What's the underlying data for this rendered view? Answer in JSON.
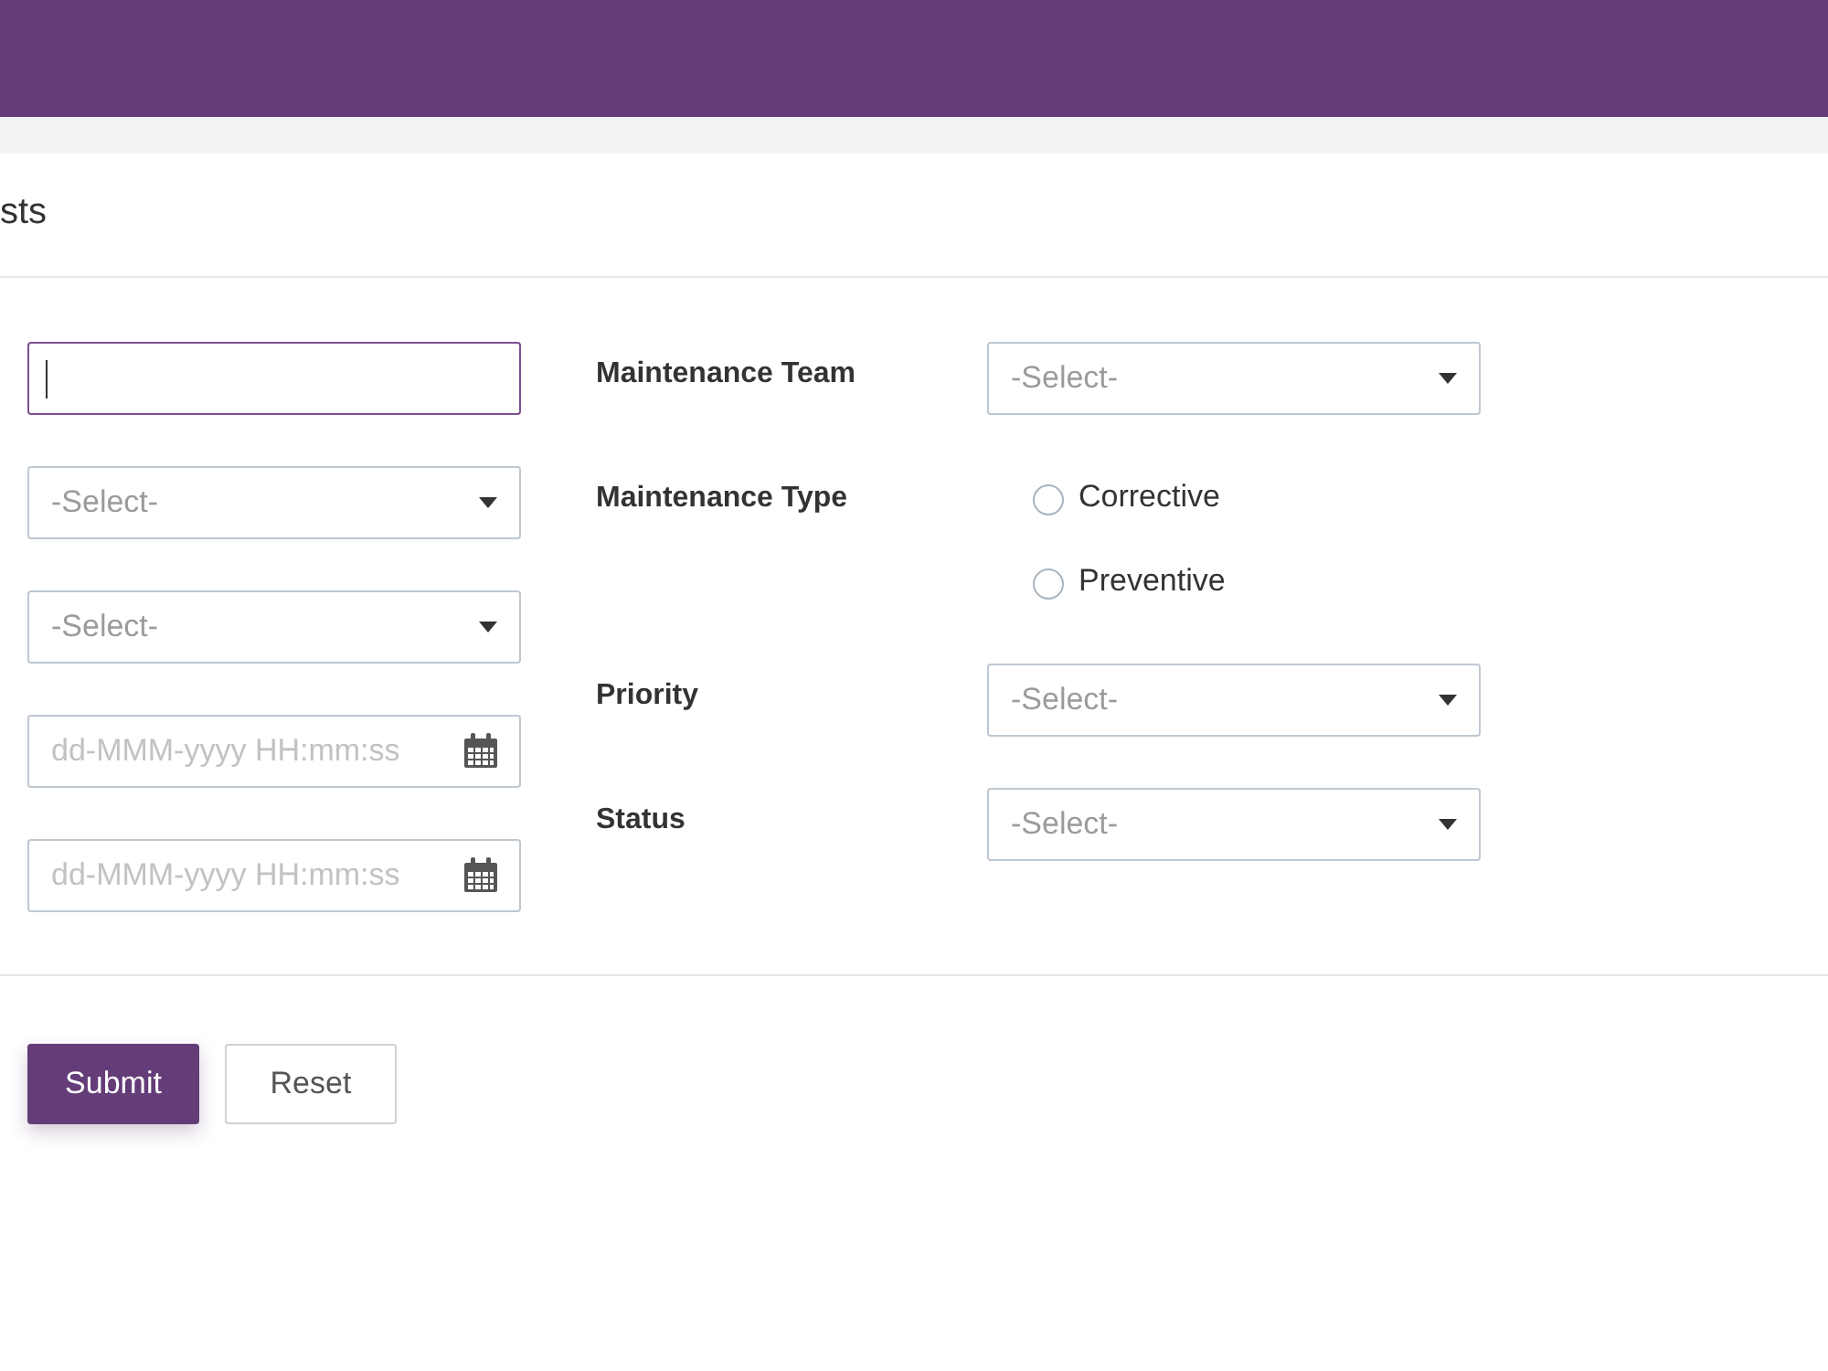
{
  "page": {
    "title": "sts"
  },
  "form": {
    "left_fields": [
      {
        "kind": "text",
        "focused": true
      },
      {
        "kind": "select",
        "placeholder": "-Select-",
        "focused": false
      },
      {
        "kind": "select",
        "placeholder": "-Select-",
        "focused": false
      },
      {
        "kind": "datetime",
        "placeholder": "dd-MMM-yyyy HH:mm:ss",
        "focused": false
      },
      {
        "kind": "datetime",
        "placeholder": "dd-MMM-yyyy HH:mm:ss",
        "focused": false
      }
    ],
    "right_fields": [
      {
        "label": "Maintenance Team",
        "kind": "select",
        "placeholder": "-Select-"
      },
      {
        "label": "Maintenance Type",
        "kind": "radio",
        "options": [
          {
            "label": "Corrective",
            "selected": false
          },
          {
            "label": "Preventive",
            "selected": false
          }
        ]
      },
      {
        "label": "Priority",
        "kind": "select",
        "placeholder": "-Select-"
      },
      {
        "label": "Status",
        "kind": "select",
        "placeholder": "-Select-"
      }
    ]
  },
  "buttons": [
    {
      "label": "Submit",
      "kind": "primary"
    },
    {
      "label": "Reset",
      "kind": "secondary"
    }
  ]
}
